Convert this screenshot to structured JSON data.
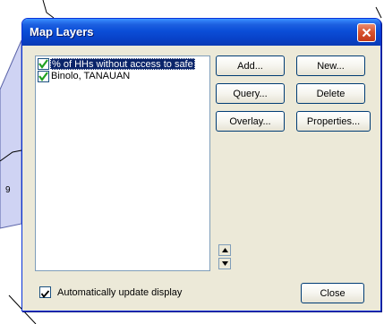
{
  "dialog": {
    "title": "Map Layers"
  },
  "layers": [
    {
      "label": "% of HHs without access to safe",
      "checked": true,
      "selected": true
    },
    {
      "label": "Binolo, TANAUAN",
      "checked": true,
      "selected": false
    }
  ],
  "buttons": {
    "add": "Add...",
    "new": "New...",
    "query": "Query...",
    "delete": "Delete",
    "overlay": "Overlay...",
    "properties": "Properties...",
    "close": "Close"
  },
  "auto_update": {
    "label": "Automatically update display",
    "checked": true
  },
  "background": {
    "map_label": "9"
  },
  "icons": {
    "close": "close-x-icon",
    "move_up": "arrow-up-icon",
    "move_down": "arrow-down-icon",
    "check": "checkmark-icon"
  },
  "colors": {
    "title_bar": "#0b4ed8",
    "close_button": "#d9542f",
    "selection": "#0a246a",
    "map_polygon": "#cfd3f3",
    "checkmark": "#21a121"
  }
}
